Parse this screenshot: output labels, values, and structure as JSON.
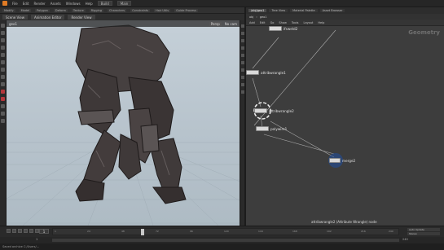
{
  "menubar": {
    "items": [
      "File",
      "Edit",
      "Render",
      "Assets",
      "Windows",
      "Help"
    ],
    "desktop": "Build",
    "field": "Main"
  },
  "shelf": {
    "items": [
      "Modify",
      "Model",
      "Polygon",
      "Deform",
      "Texture",
      "Rigging",
      "Characters",
      "Constraints",
      "Hair Utils",
      "Guide Process"
    ]
  },
  "viewport_tabs": [
    "Scene View",
    "Animation Editor",
    "Render View"
  ],
  "viewport": {
    "object_label": "geo1",
    "camera_label": "Persp",
    "cam_menu": "No cam"
  },
  "network": {
    "tabs": [
      "/obj/geo1",
      "Tree View",
      "Material Palette",
      "Asset Browser"
    ],
    "path": [
      "obj",
      "geo1"
    ],
    "menu": [
      "Add",
      "Edit",
      "Go",
      "Show",
      "Tools",
      "Layout",
      "Help"
    ],
    "context_label": "Geometry",
    "nodes": [
      {
        "label": "ifsweld2",
        "sub": ""
      },
      {
        "label": "attribwrangle1",
        "sub": ""
      },
      {
        "label": "attribwrangle2",
        "sub": ""
      },
      {
        "label": "polywire1",
        "sub": ""
      },
      {
        "label": "merge2",
        "sub": ""
      }
    ],
    "selected_info": "attribwrangle2 (Attribute Wrangle) node"
  },
  "timeline": {
    "current_frame": "1",
    "ticks": [
      "1",
      "24",
      "48",
      "72",
      "96",
      "120",
      "144",
      "168",
      "192",
      "216",
      "240"
    ],
    "right_controls": [
      "Auto Update",
      "Stereo"
    ]
  },
  "range": {
    "start": "1",
    "end": "240"
  },
  "status": "Saved archive C:/Users/..."
}
